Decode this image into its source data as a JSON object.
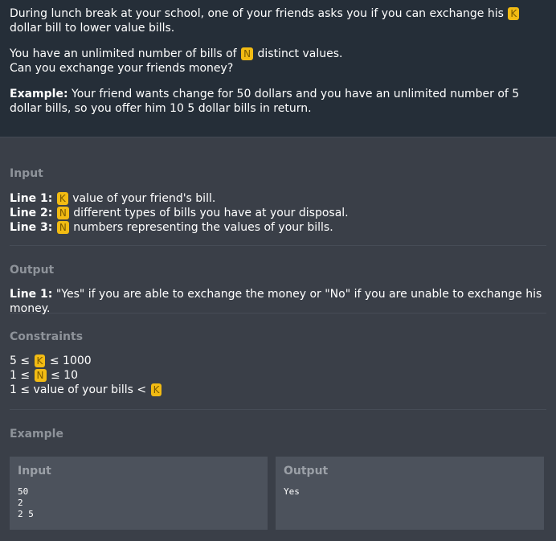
{
  "statement": {
    "p1_before": "During lunch break at your school, one of your friends asks you if you can exchange his ",
    "p1_var": "K",
    "p1_after": " dollar bill to lower value bills.",
    "p2_before": "You have an unlimited number of bills of ",
    "p2_var": "N",
    "p2_after": " distinct values.",
    "p2_line2": "Can you exchange your friends money?",
    "p3_bold": "Example:",
    "p3_text": " Your friend wants change for 50 dollars and you have an unlimited number of 5 dollar bills, so you offer him 10 5 dollar bills in return."
  },
  "input_section": {
    "title": "Input",
    "lines": [
      {
        "label": "Line 1:",
        "var": "K",
        "text": "value of your friend's bill."
      },
      {
        "label": "Line 2:",
        "var": "N",
        "text": "different types of bills you have at your disposal."
      },
      {
        "label": "Line 3:",
        "var": "N",
        "text": "numbers representing the values of your bills."
      }
    ]
  },
  "output_section": {
    "title": "Output",
    "label": "Line 1:",
    "text": " \"Yes\" if you are able to exchange the money or \"No\" if you are unable to exchange his money."
  },
  "constraints_section": {
    "title": "Constraints",
    "lines": [
      {
        "before": "5 ≤ ",
        "var": "K",
        "after": " ≤ 1000"
      },
      {
        "before": "1 ≤ ",
        "var": "N",
        "after": " ≤ 10"
      },
      {
        "before": "1 ≤ value of your bills < ",
        "var": "K",
        "after": ""
      }
    ]
  },
  "example_section": {
    "title": "Example",
    "input_title": "Input",
    "input_text": "50\n2\n2 5",
    "output_title": "Output",
    "output_text": "Yes"
  },
  "colors": {
    "header_bg": "#252e38",
    "body_bg": "#3a3f48",
    "var_bg": "#f2bb13",
    "section_title": "#8e939a",
    "example_box_bg": "#4c525c"
  }
}
